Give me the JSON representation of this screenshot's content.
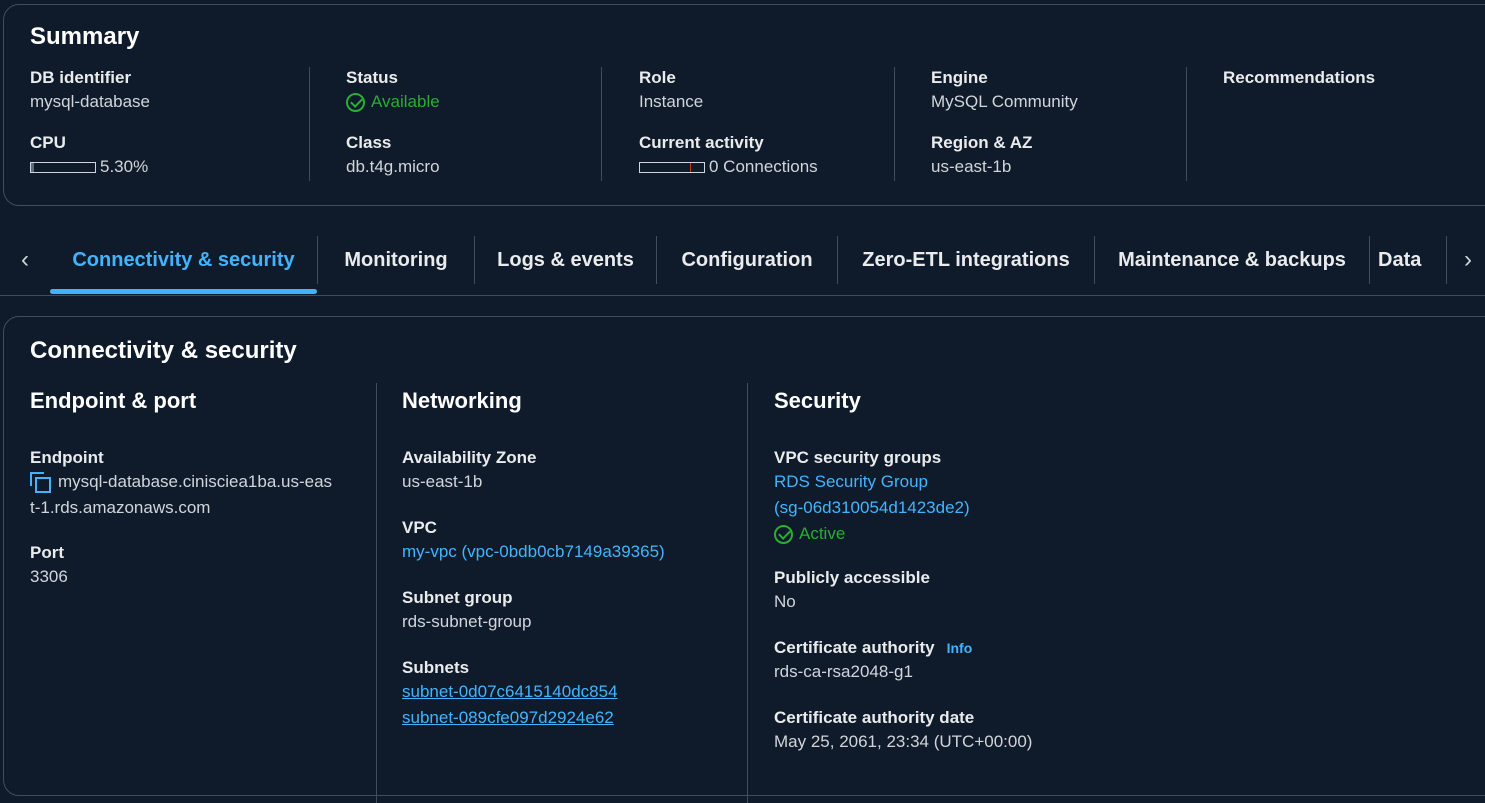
{
  "summary": {
    "title": "Summary",
    "db_identifier": {
      "label": "DB identifier",
      "value": "mysql-database"
    },
    "cpu": {
      "label": "CPU",
      "value": "5.30%",
      "fraction": 0.053
    },
    "status": {
      "label": "Status",
      "value": "Available"
    },
    "class": {
      "label": "Class",
      "value": "db.t4g.micro"
    },
    "role": {
      "label": "Role",
      "value": "Instance"
    },
    "current_activity": {
      "label": "Current activity",
      "value": "0 Connections"
    },
    "engine": {
      "label": "Engine",
      "value": "MySQL Community"
    },
    "region": {
      "label": "Region & AZ",
      "value": "us-east-1b"
    },
    "recommendations": {
      "label": "Recommendations"
    }
  },
  "tabs": [
    {
      "label": "Connectivity & security",
      "active": true
    },
    {
      "label": "Monitoring"
    },
    {
      "label": "Logs & events"
    },
    {
      "label": "Configuration"
    },
    {
      "label": "Zero-ETL integrations"
    },
    {
      "label": "Maintenance & backups"
    },
    {
      "label": "Data"
    }
  ],
  "connectivity": {
    "title": "Connectivity & security",
    "endpoint_port": {
      "heading": "Endpoint & port",
      "endpoint_label": "Endpoint",
      "endpoint_line1": "mysql-database.cinisciea1ba.us-eas",
      "endpoint_line2": "t-1.rds.amazonaws.com",
      "port_label": "Port",
      "port_value": "3306"
    },
    "networking": {
      "heading": "Networking",
      "az_label": "Availability Zone",
      "az_value": "us-east-1b",
      "vpc_label": "VPC",
      "vpc_value": "my-vpc (vpc-0bdb0cb7149a39365)",
      "subnet_group_label": "Subnet group",
      "subnet_group_value": "rds-subnet-group",
      "subnets_label": "Subnets",
      "subnets": [
        "subnet-0d07c6415140dc854",
        "subnet-089cfe097d2924e62"
      ]
    },
    "security": {
      "heading": "Security",
      "sg_label": "VPC security groups",
      "sg_name": "RDS Security Group",
      "sg_id": "(sg-06d310054d1423de2)",
      "sg_status": "Active",
      "public_label": "Publicly accessible",
      "public_value": "No",
      "ca_label": "Certificate authority",
      "ca_info": "Info",
      "ca_value": "rds-ca-rsa2048-g1",
      "ca_date_label": "Certificate authority date",
      "ca_date_value": "May 25, 2061, 23:34 (UTC+00:00)"
    }
  },
  "colors": {
    "background": "#0f1b2a",
    "accent": "#42b4ff",
    "success": "#29ad32",
    "border": "#414d5c"
  }
}
